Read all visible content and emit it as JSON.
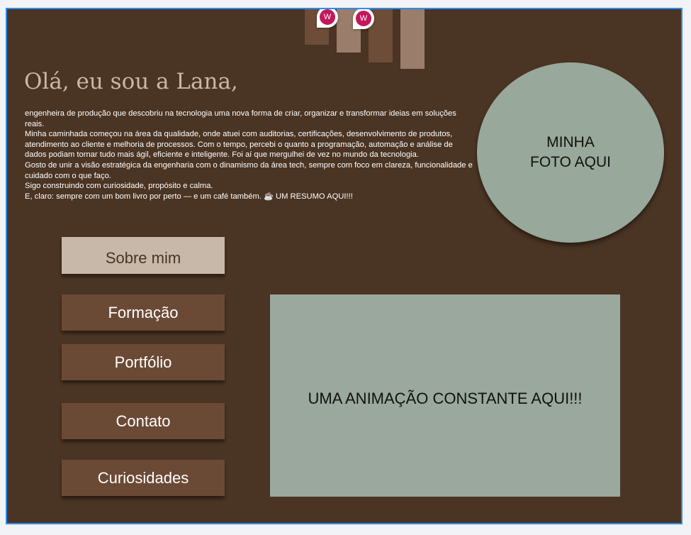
{
  "header": {
    "greeting": "Olá, eu sou a Lana,"
  },
  "bio": {
    "paragraphs": [
      "engenheira de produção que descobriu na tecnologia uma nova forma de criar, organizar e transformar ideias em soluções reais.",
      "Minha caminhada começou na área da qualidade, onde atuei com auditorias, certificações, desenvolvimento de produtos, atendimento ao cliente e melhoria de processos. Com o tempo, percebi o quanto a programação, automação e análise de dados podiam tornar tudo mais ágil, eficiente e inteligente. Foi aí que mergulhei de vez no mundo da tecnologia.",
      "Gosto de unir a visão estratégica da engenharia com o dinamismo da área tech, sempre com foco em clareza, funcionalidade e cuidado com o que faço.",
      "Sigo construindo com curiosidade, propósito e calma.",
      "E, claro: sempre com um bom livro por perto — e um café também. ☕ UM RESUMO AQUI!!!"
    ]
  },
  "photo": {
    "placeholder": "MINHA\nFOTO AQUI"
  },
  "nav": {
    "items": [
      {
        "label": "Sobre mim"
      },
      {
        "label": "Formação"
      },
      {
        "label": "Portfólio"
      },
      {
        "label": "Contato"
      },
      {
        "label": "Curiosidades"
      }
    ]
  },
  "animation": {
    "placeholder": "UMA ANIMAÇÃO CONSTANTE AQUI!!!"
  },
  "comments": {
    "avatar_letter": "W",
    "avatar_color": "#c2185b"
  },
  "colors": {
    "background": "#4a3423",
    "button": "#6b4a35",
    "button_active": "#c8b8a9",
    "panel": "#98a89b",
    "selection": "#2b8de8"
  }
}
